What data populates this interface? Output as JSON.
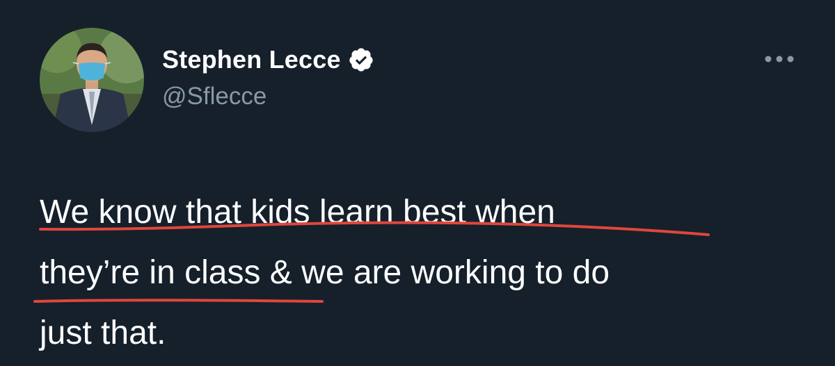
{
  "author": {
    "display_name": "Stephen Lecce",
    "handle": "@Sflecce",
    "verified": true
  },
  "tweet": {
    "lines": [
      "We know that kids learn best when",
      "they’re in class & we are working to do",
      "just that."
    ]
  },
  "icons": {
    "verified": "verified-badge-icon",
    "more": "more-options-icon"
  },
  "colors": {
    "background": "#15202b",
    "text": "#ffffff",
    "secondary_text": "#8899a6",
    "annotation_underline": "#e0463c"
  }
}
